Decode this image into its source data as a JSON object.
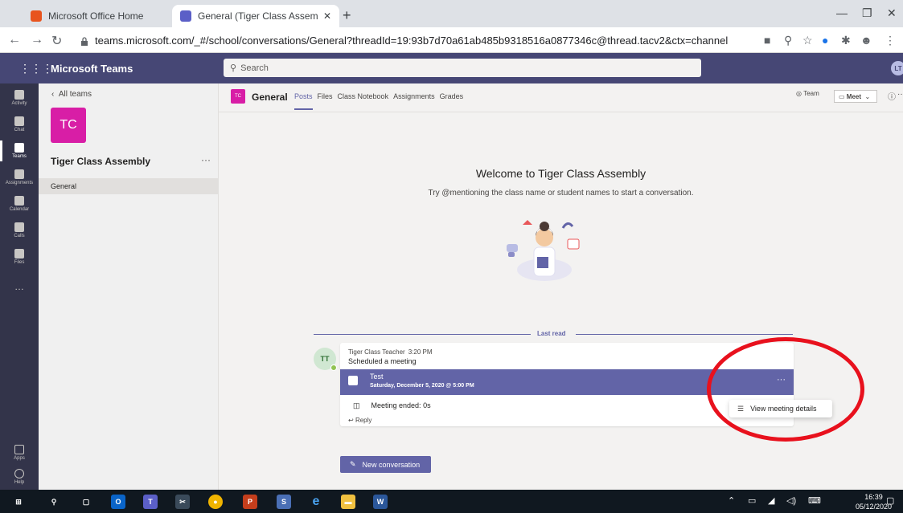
{
  "browser": {
    "tabs": [
      {
        "title": "Microsoft Office Home",
        "favicon": "office-icon",
        "active": false
      },
      {
        "title": "General (Tiger Class Assembly) | M",
        "favicon": "teams-icon",
        "active": true
      }
    ],
    "url": "teams.microsoft.com/_#/school/conversations/General?threadId=19:93b7d70a61ab485b9318516a0877346c@thread.tacv2&ctx=channel"
  },
  "teams": {
    "app_name": "Microsoft Teams",
    "search_placeholder": "Search",
    "me_initials": "LT"
  },
  "app_bar": {
    "items": [
      {
        "label": "Activity",
        "icon": "bell-icon"
      },
      {
        "label": "Chat",
        "icon": "chat-icon"
      },
      {
        "label": "Teams",
        "icon": "teams-icon",
        "active": true
      },
      {
        "label": "Assignments",
        "icon": "assignments-icon"
      },
      {
        "label": "Calendar",
        "icon": "calendar-icon"
      },
      {
        "label": "Calls",
        "icon": "phone-icon"
      },
      {
        "label": "Files",
        "icon": "files-icon"
      },
      {
        "label": "…",
        "icon": "more-icon"
      }
    ],
    "bottom_items": [
      {
        "label": "Apps",
        "icon": "apps-icon"
      },
      {
        "label": "Help",
        "icon": "help-icon"
      }
    ]
  },
  "left_pane": {
    "back_label": "All teams",
    "team_initials": "TC",
    "team_name": "Tiger Class Assembly",
    "more": "···",
    "channels": [
      "General"
    ]
  },
  "channel_header": {
    "icon_initials": "TC",
    "title": "General",
    "tabs": [
      "Posts",
      "Files",
      "Class Notebook",
      "Assignments",
      "Grades"
    ],
    "active_tab": "Posts",
    "team_button": "Team",
    "meet_button": "Meet",
    "info": "ⓘ",
    "more": "···"
  },
  "welcome": {
    "title": "Welcome to Tiger Class Assembly",
    "subtitle": "Try @mentioning the class name or student names to start a conversation."
  },
  "last_read_label": "Last read",
  "message": {
    "avatar_initials": "TT",
    "author": "Tiger Class Teacher",
    "time": "3:20 PM",
    "action": "Scheduled a meeting",
    "meeting_title": "Test",
    "meeting_date": "Saturday, December 5, 2020 @ 5:00 PM",
    "meeting_more": "···",
    "meeting_status": "Meeting ended: 0s",
    "reply_label": "Reply"
  },
  "context_menu": {
    "item": "View meeting details"
  },
  "new_conversation_label": "New conversation",
  "taskbar": {
    "time": "16:39",
    "date": "05/12/2020"
  },
  "colors": {
    "teams_purple": "#464775",
    "accent": "#6264a7",
    "team_tile": "#d81ea6",
    "annotation_red": "#e8111d"
  }
}
